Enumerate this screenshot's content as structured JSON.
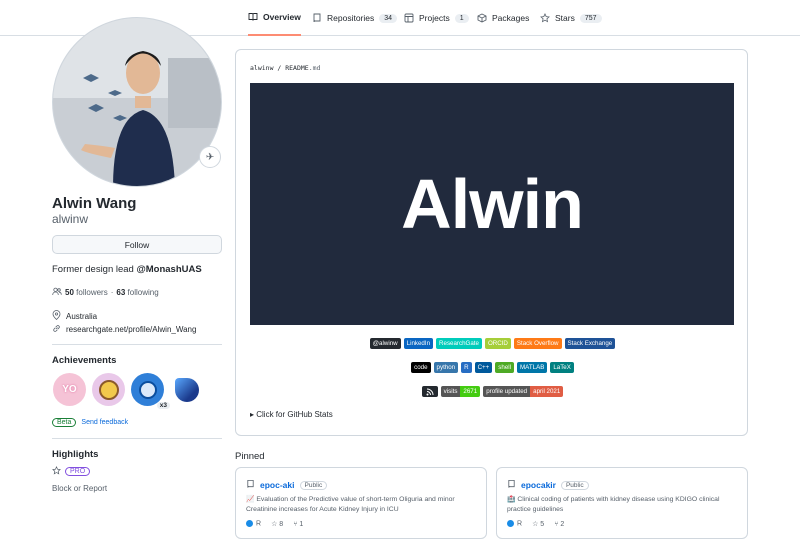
{
  "tabs": [
    {
      "label": "Overview",
      "count": null,
      "icon": "book-icon"
    },
    {
      "label": "Repositories",
      "count": "34",
      "icon": "repo-icon"
    },
    {
      "label": "Projects",
      "count": "1",
      "icon": "project-icon"
    },
    {
      "label": "Packages",
      "count": null,
      "icon": "package-icon"
    },
    {
      "label": "Stars",
      "count": "757",
      "icon": "star-icon"
    }
  ],
  "profile": {
    "name": "Alwin Wang",
    "login": "alwinw",
    "follow_label": "Follow",
    "bio_prefix": "Former design lead ",
    "bio_org": "@MonashUAS",
    "followers_count": "50",
    "followers_label": "followers",
    "following_count": "63",
    "following_label": "following",
    "location": "Australia",
    "website": "researchgate.net/profile/Alwin_Wang"
  },
  "achievements": {
    "title": "Achievements",
    "items": [
      "yolo",
      "quickdraw",
      "pull-shark",
      "starstruck"
    ],
    "pull_shark_multiplier": "x3",
    "beta_label": "Beta",
    "feedback_label": "Send feedback"
  },
  "highlights": {
    "title": "Highlights",
    "pro_label": "PRO",
    "block_label": "Block or Report"
  },
  "readme": {
    "path_user": "alwinw",
    "path_sep": " / ",
    "path_file": "README",
    "path_ext": ".md",
    "banner_text": "Alwin",
    "row1": [
      {
        "label": "@alwinw",
        "color": "#24292f"
      },
      {
        "label": "LinkedIn",
        "color": "#0a66c2"
      },
      {
        "label": "ResearchGate",
        "color": "#00ccbb"
      },
      {
        "label": "ORCID",
        "color": "#a6ce39"
      },
      {
        "label": "Stack Overflow",
        "color": "#fe7a16"
      },
      {
        "label": "Stack Exchange",
        "color": "#1e5297"
      }
    ],
    "row2": [
      {
        "label": "code",
        "color": "#000000"
      },
      {
        "label": "python",
        "color": "#3776ab"
      },
      {
        "label": "R",
        "color": "#276dc3"
      },
      {
        "label": "C++",
        "color": "#00599c"
      },
      {
        "label": "shell",
        "color": "#4eaa25"
      },
      {
        "label": "MATLAB",
        "color": "#0076a8"
      },
      {
        "label": "LaTeX",
        "color": "#008080"
      }
    ],
    "row3": [
      {
        "label": "",
        "value": "",
        "color": "#24292f",
        "value_color": "#24292f"
      },
      {
        "label": "visits",
        "value": "2671",
        "color": "#555555",
        "value_color": "#4c1"
      },
      {
        "label": "profile updated",
        "value": "april 2021",
        "color": "#555555",
        "value_color": "#e05d44"
      }
    ],
    "stats_label": "▸ Click for GitHub Stats"
  },
  "pinned": {
    "title": "Pinned",
    "repos": [
      {
        "name": "epoc-aki",
        "visibility": "Public",
        "description": "📈 Evaluation of the Predictive value of short-term Oliguria and minor Creatinine increases for Acute Kidney Injury in ICU",
        "language": "R",
        "stars": "8",
        "forks": "1"
      },
      {
        "name": "epocakir",
        "visibility": "Public",
        "description": "🏥 Clinical coding of patients with kidney disease using KDIGO clinical practice guidelines",
        "language": "R",
        "stars": "5",
        "forks": "2"
      }
    ]
  }
}
